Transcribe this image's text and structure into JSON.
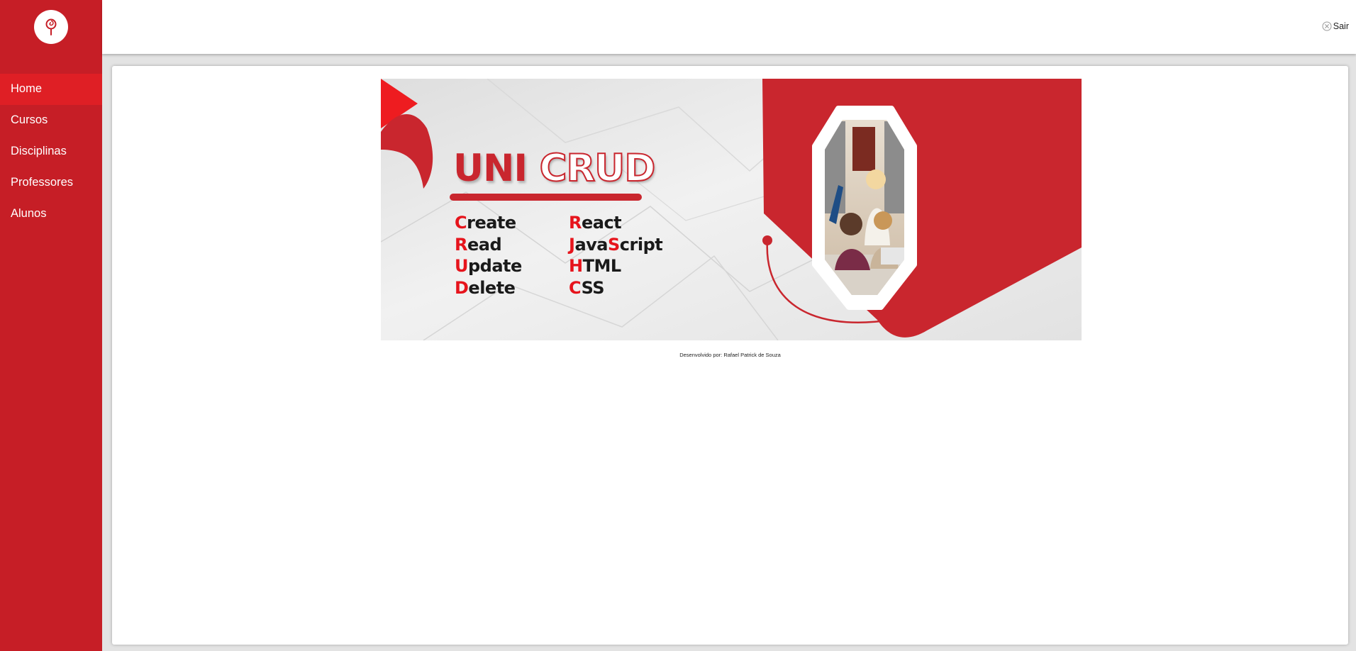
{
  "sidebar": {
    "items": [
      {
        "label": "Home",
        "active": true
      },
      {
        "label": "Cursos",
        "active": false
      },
      {
        "label": "Disciplinas",
        "active": false
      },
      {
        "label": "Professores",
        "active": false
      },
      {
        "label": "Alunos",
        "active": false
      }
    ]
  },
  "header": {
    "logout_label": "Sair"
  },
  "banner": {
    "title_part1": "UNI",
    "title_part2": "CRUD",
    "crud_words": [
      {
        "first": "C",
        "rest": "reate"
      },
      {
        "first": "R",
        "rest": "ead"
      },
      {
        "first": "U",
        "rest": "pdate"
      },
      {
        "first": "D",
        "rest": "elete"
      }
    ],
    "tech_words": [
      {
        "first": "R",
        "rest": "eact"
      },
      {
        "first": "J",
        "rest": "ava",
        "mid": "S",
        "tail": "cript"
      },
      {
        "first": "H",
        "rest": "TML"
      },
      {
        "first": "C",
        "rest": "SS"
      }
    ]
  },
  "footer": {
    "credit": "Desenvolvido por: Rafael Patrick de Souza"
  },
  "colors": {
    "sidebar_bg": "#c61e26",
    "active_item_bg": "#df1f25",
    "brand_red": "#c9262e",
    "highlight_red": "#e6141c"
  }
}
